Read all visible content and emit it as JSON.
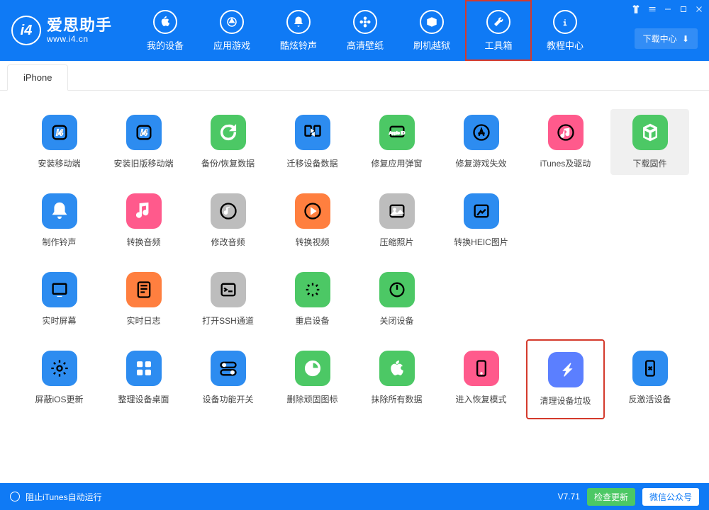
{
  "app": {
    "name": "爱思助手",
    "url": "www.i4.cn"
  },
  "nav": [
    {
      "label": "我的设备",
      "icon": "apple"
    },
    {
      "label": "应用游戏",
      "icon": "apps"
    },
    {
      "label": "酷炫铃声",
      "icon": "bell"
    },
    {
      "label": "高清壁纸",
      "icon": "flower"
    },
    {
      "label": "刷机越狱",
      "icon": "box"
    },
    {
      "label": "工具箱",
      "icon": "tools",
      "active": true
    },
    {
      "label": "教程中心",
      "icon": "info"
    }
  ],
  "download_center": "下载中心",
  "tab": "iPhone",
  "tools": [
    {
      "label": "安装移动端",
      "icon": "i4",
      "c": "#2d8cf0"
    },
    {
      "label": "安装旧版移动端",
      "icon": "i4",
      "c": "#2d8cf0"
    },
    {
      "label": "备份/恢复数据",
      "icon": "restore",
      "c": "#4cc865"
    },
    {
      "label": "迁移设备数据",
      "icon": "transfer",
      "c": "#2d8cf0"
    },
    {
      "label": "修复应用弹窗",
      "icon": "appleid",
      "c": "#4cc865"
    },
    {
      "label": "修复游戏失效",
      "icon": "appstore",
      "c": "#2d8cf0"
    },
    {
      "label": "iTunes及驱动",
      "icon": "itunes",
      "c": "#ff5a8c"
    },
    {
      "label": "下载固件",
      "icon": "cube",
      "c": "#4cc865",
      "hover": true
    },
    {
      "label": "制作铃声",
      "icon": "bell",
      "c": "#2d8cf0"
    },
    {
      "label": "转换音频",
      "icon": "note",
      "c": "#ff5a8c"
    },
    {
      "label": "修改音频",
      "icon": "note2",
      "c": "#bdbdbd"
    },
    {
      "label": "转换视频",
      "icon": "play",
      "c": "#ff7f3f"
    },
    {
      "label": "压缩照片",
      "icon": "image",
      "c": "#bdbdbd"
    },
    {
      "label": "转换HEIC图片",
      "icon": "heic",
      "c": "#2d8cf0"
    },
    {
      "label": "",
      "icon": "",
      "c": "",
      "spacer": true
    },
    {
      "label": "",
      "icon": "",
      "c": "",
      "spacer": true
    },
    {
      "label": "实时屏幕",
      "icon": "screen",
      "c": "#2d8cf0"
    },
    {
      "label": "实时日志",
      "icon": "log",
      "c": "#ff7f3f"
    },
    {
      "label": "打开SSH通道",
      "icon": "ssh",
      "c": "#bdbdbd"
    },
    {
      "label": "重启设备",
      "icon": "loading",
      "c": "#4cc865"
    },
    {
      "label": "关闭设备",
      "icon": "power",
      "c": "#4cc865"
    },
    {
      "label": "",
      "icon": "",
      "c": "",
      "spacer": true
    },
    {
      "label": "",
      "icon": "",
      "c": "",
      "spacer": true
    },
    {
      "label": "",
      "icon": "",
      "c": "",
      "spacer": true
    },
    {
      "label": "屏蔽iOS更新",
      "icon": "gear",
      "c": "#2d8cf0"
    },
    {
      "label": "整理设备桌面",
      "icon": "grid",
      "c": "#2d8cf0"
    },
    {
      "label": "设备功能开关",
      "icon": "toggle",
      "c": "#2d8cf0"
    },
    {
      "label": "删除顽固图标",
      "icon": "pie",
      "c": "#4cc865"
    },
    {
      "label": "抹除所有数据",
      "icon": "apple2",
      "c": "#4cc865"
    },
    {
      "label": "进入恢复模式",
      "icon": "device",
      "c": "#ff5a8c"
    },
    {
      "label": "清理设备垃圾",
      "icon": "flash",
      "c": "#5b7fff",
      "highlight": true
    },
    {
      "label": "反激活设备",
      "icon": "device2",
      "c": "#2d8cf0"
    }
  ],
  "footer": {
    "itunes": "阻止iTunes自动运行",
    "version": "V7.71",
    "check": "检查更新",
    "wechat": "微信公众号"
  }
}
